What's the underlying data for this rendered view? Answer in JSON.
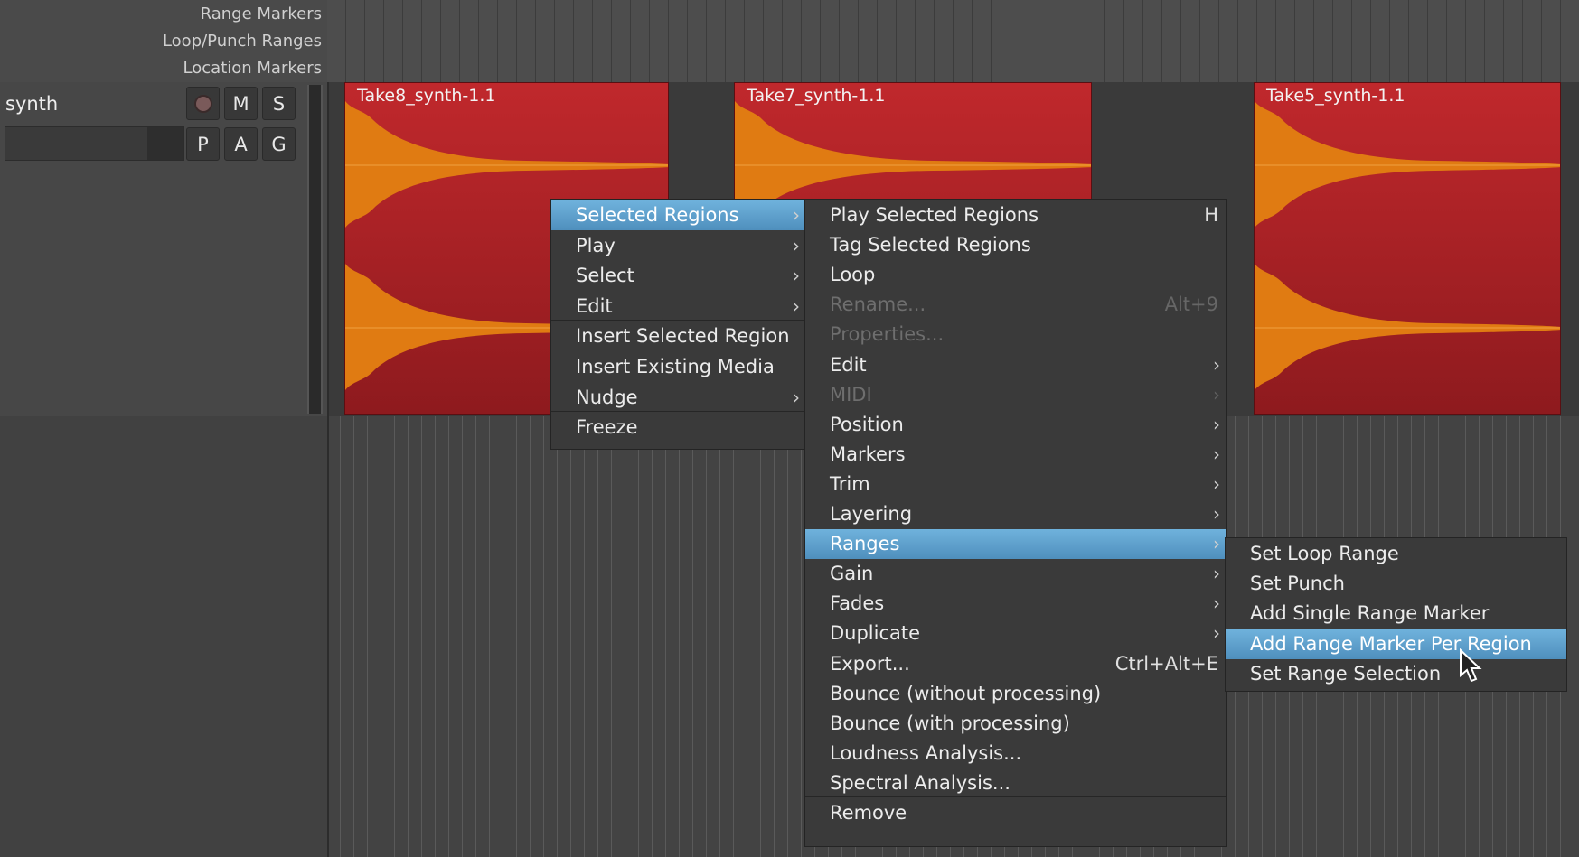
{
  "rulers": {
    "range_markers": "Range Markers",
    "loop_punch": "Loop/Punch Ranges",
    "location_markers": "Location Markers"
  },
  "track": {
    "name": "synth",
    "buttons": {
      "mute": "M",
      "solo": "S",
      "playlist": "P",
      "automation": "A",
      "group": "G"
    }
  },
  "regions": [
    {
      "name": "Take8_synth-1.1"
    },
    {
      "name": "Take7_synth-1.1"
    },
    {
      "name": "Take5_synth-1.1"
    }
  ],
  "colors": {
    "region": "#c0282c",
    "waveform": "#e07b12",
    "highlight": "#5a9fcd"
  },
  "menu_main": [
    {
      "label": "Selected Regions",
      "submenu": true,
      "selected": true
    },
    {
      "label": "Play",
      "submenu": true
    },
    {
      "label": "Select",
      "submenu": true
    },
    {
      "label": "Edit",
      "submenu": true
    },
    {
      "label": "Insert Selected Region"
    },
    {
      "label": "Insert Existing Media"
    },
    {
      "label": "Nudge",
      "submenu": true
    },
    {
      "label": "Freeze"
    }
  ],
  "menu_regions": [
    {
      "label": "Play Selected Regions",
      "accel": "H"
    },
    {
      "label": "Tag Selected Regions"
    },
    {
      "label": "Loop"
    },
    {
      "label": "Rename...",
      "accel": "Alt+9",
      "disabled": true
    },
    {
      "label": "Properties...",
      "disabled": true
    },
    {
      "label": "Edit",
      "submenu": true
    },
    {
      "label": "MIDI",
      "submenu": true,
      "disabled": true
    },
    {
      "label": "Position",
      "submenu": true
    },
    {
      "label": "Markers",
      "submenu": true
    },
    {
      "label": "Trim",
      "submenu": true
    },
    {
      "label": "Layering",
      "submenu": true
    },
    {
      "label": "Ranges",
      "submenu": true,
      "selected": true
    },
    {
      "label": "Gain",
      "submenu": true
    },
    {
      "label": "Fades",
      "submenu": true
    },
    {
      "label": "Duplicate",
      "submenu": true
    },
    {
      "label": "Export...",
      "accel": "Ctrl+Alt+E"
    },
    {
      "label": "Bounce (without processing)"
    },
    {
      "label": "Bounce (with processing)"
    },
    {
      "label": "Loudness Analysis..."
    },
    {
      "label": "Spectral Analysis..."
    },
    {
      "label": "Remove"
    }
  ],
  "menu_ranges": [
    {
      "label": "Set Loop Range"
    },
    {
      "label": "Set Punch"
    },
    {
      "label": "Add Single Range Marker"
    },
    {
      "label": "Add Range Marker Per Region",
      "selected": true
    },
    {
      "label": "Set Range Selection"
    }
  ],
  "icons": {
    "submenu_arrow": "›",
    "cursor": "arrow-cursor-icon",
    "record": "record-icon"
  }
}
